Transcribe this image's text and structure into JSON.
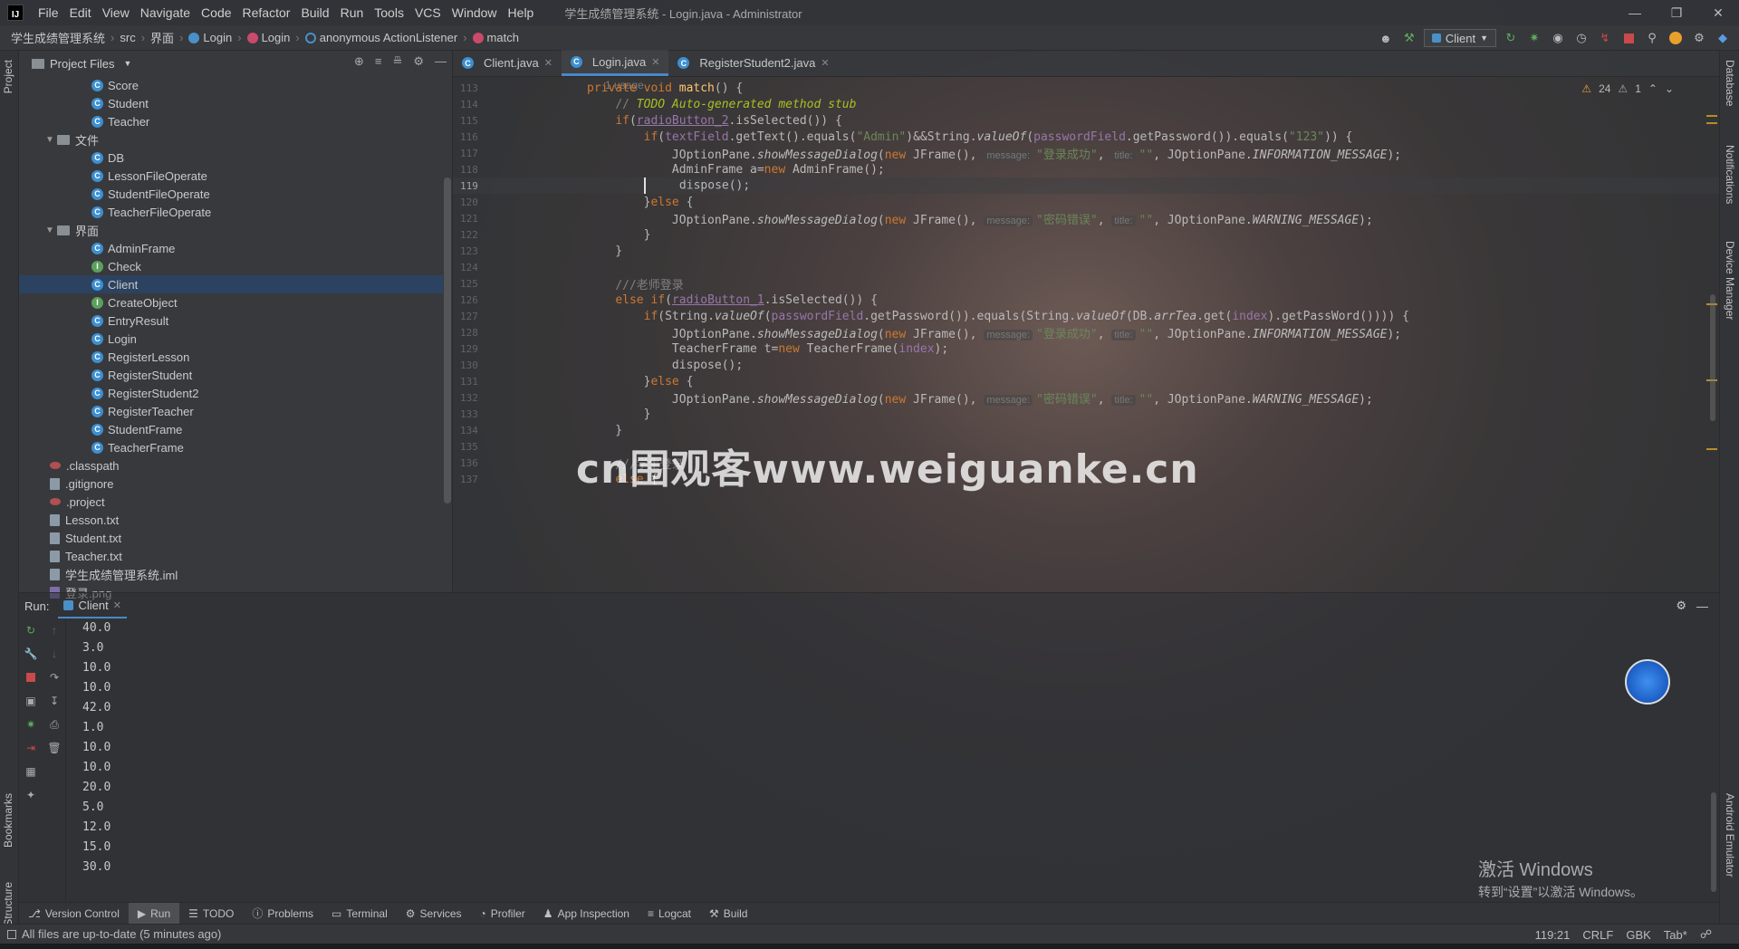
{
  "titlebar": {
    "logo": "IJ",
    "menus": [
      "File",
      "Edit",
      "View",
      "Navigate",
      "Code",
      "Refactor",
      "Build",
      "Run",
      "Tools",
      "VCS",
      "Window",
      "Help"
    ],
    "title": "学生成绩管理系统 - Login.java - Administrator"
  },
  "breadcrumbs": [
    "学生成绩管理系统",
    "src",
    "界面",
    "Login",
    "Login",
    "anonymous ActionListener",
    "match"
  ],
  "run_config": "Client",
  "project_panel": {
    "title": "Project Files",
    "tree": [
      {
        "label": "Score",
        "kind": "class",
        "indent": 3
      },
      {
        "label": "Student",
        "kind": "class",
        "indent": 3
      },
      {
        "label": "Teacher",
        "kind": "class",
        "indent": 3
      },
      {
        "label": "文件",
        "kind": "folder",
        "indent": 2
      },
      {
        "label": "DB",
        "kind": "class",
        "indent": 3
      },
      {
        "label": "LessonFileOperate",
        "kind": "class",
        "indent": 3
      },
      {
        "label": "StudentFileOperate",
        "kind": "class",
        "indent": 3
      },
      {
        "label": "TeacherFileOperate",
        "kind": "class",
        "indent": 3
      },
      {
        "label": "界面",
        "kind": "folder",
        "indent": 2
      },
      {
        "label": "AdminFrame",
        "kind": "class",
        "indent": 3
      },
      {
        "label": "Check",
        "kind": "iface",
        "indent": 3
      },
      {
        "label": "Client",
        "kind": "class",
        "indent": 3,
        "selected": true
      },
      {
        "label": "CreateObject",
        "kind": "iface",
        "indent": 3
      },
      {
        "label": "EntryResult",
        "kind": "class",
        "indent": 3
      },
      {
        "label": "Login",
        "kind": "class",
        "indent": 3
      },
      {
        "label": "RegisterLesson",
        "kind": "class",
        "indent": 3
      },
      {
        "label": "RegisterStudent",
        "kind": "class",
        "indent": 3
      },
      {
        "label": "RegisterStudent2",
        "kind": "class",
        "indent": 3
      },
      {
        "label": "RegisterTeacher",
        "kind": "class",
        "indent": 3
      },
      {
        "label": "StudentFrame",
        "kind": "class",
        "indent": 3
      },
      {
        "label": "TeacherFrame",
        "kind": "class",
        "indent": 3
      },
      {
        "label": ".classpath",
        "kind": "dot",
        "indent": 1
      },
      {
        "label": ".gitignore",
        "kind": "file",
        "indent": 1
      },
      {
        "label": ".project",
        "kind": "dot",
        "indent": 1
      },
      {
        "label": "Lesson.txt",
        "kind": "file",
        "indent": 1
      },
      {
        "label": "Student.txt",
        "kind": "file",
        "indent": 1
      },
      {
        "label": "Teacher.txt",
        "kind": "file",
        "indent": 1
      },
      {
        "label": "学生成绩管理系统.iml",
        "kind": "file",
        "indent": 1
      },
      {
        "label": "登录.png",
        "kind": "png",
        "indent": 1
      }
    ]
  },
  "tabs": [
    {
      "label": "Client.java",
      "active": false
    },
    {
      "label": "Login.java",
      "active": true
    },
    {
      "label": "RegisterStudent2.java",
      "active": false
    }
  ],
  "inspections": {
    "warnings": "24",
    "weak": "1"
  },
  "editor": {
    "usage_hint": "1 usage",
    "lines": [
      {
        "n": "113",
        "html": "<span class='kw'>private void </span><span class='fn'>match</span>() {"
      },
      {
        "n": "114",
        "html": "    <span class='cm'>// </span><span class='todo'>TODO Auto-generated method stub</span>"
      },
      {
        "n": "115",
        "html": "    <span class='kw'>if</span>(<span class='fld und'>radioButton_2</span>.isSelected()) {"
      },
      {
        "n": "116",
        "html": "        <span class='kw'>if</span>(<span class='fld'>textField</span>.getText().equals(<span class='str'>\"Admin\"</span>)&amp;&amp;String.<span class='st'>valueOf</span>(<span class='fld'>passwordField</span>.getPassword()).equals(<span class='str'>\"123\"</span>)) {"
      },
      {
        "n": "117",
        "html": "            JOptionPane.<span class='st'>showMessageDialog</span>(<span class='kw'>new </span>JFrame(), <span class='hint'>message:</span><span class='str'>\"登录成功\"</span>, <span class='hint'>title:</span><span class='str'>\"\"</span>, JOptionPane.<span class='fld st'>INFORMATION_MESSAGE</span>);"
      },
      {
        "n": "118",
        "html": "            AdminFrame a=<span class='kw'>new </span>AdminFrame();"
      },
      {
        "n": "119",
        "html": "        <span class='caret'></span>    dispose();",
        "cur": true
      },
      {
        "n": "120",
        "html": "        }<span class='kw'>else </span>{"
      },
      {
        "n": "121",
        "html": "            JOptionPane.<span class='st'>showMessageDialog</span>(<span class='kw'>new </span>JFrame(), <span class='hint'>message:</span><span class='str'>\"密码错误\"</span>, <span class='hint'>title:</span><span class='str'>\"\"</span>, JOptionPane.<span class='fld st'>WARNING_MESSAGE</span>);"
      },
      {
        "n": "122",
        "html": "        }"
      },
      {
        "n": "123",
        "html": "    }"
      },
      {
        "n": "124",
        "html": ""
      },
      {
        "n": "125",
        "html": "    <span class='cm'>///老师登录</span>"
      },
      {
        "n": "126",
        "html": "    <span class='kw'>else if</span>(<span class='fld und'>radioButton_1</span>.isSelected()) {"
      },
      {
        "n": "127",
        "html": "        <span class='kw'>if</span>(String.<span class='st'>valueOf</span>(<span class='fld'>passwordField</span>.getPassword()).equals(String.<span class='st'>valueOf</span>(DB.<span class='fld st'>arrTea</span>.get(<span class='fld'>index</span>).getPassWord()))) {"
      },
      {
        "n": "128",
        "html": "            JOptionPane.<span class='st'>showMessageDialog</span>(<span class='kw'>new </span>JFrame(), <span class='hint'>message:</span><span class='str'>\"登录成功\"</span>, <span class='hint'>title:</span><span class='str'>\"\"</span>, JOptionPane.<span class='fld st'>INFORMATION_MESSAGE</span>);"
      },
      {
        "n": "129",
        "html": "            TeacherFrame t=<span class='kw'>new </span>TeacherFrame(<span class='fld'>index</span>);"
      },
      {
        "n": "130",
        "html": "            dispose();"
      },
      {
        "n": "131",
        "html": "        }<span class='kw'>else </span>{"
      },
      {
        "n": "132",
        "html": "            JOptionPane.<span class='st'>showMessageDialog</span>(<span class='kw'>new </span>JFrame(), <span class='hint'>message:</span><span class='str'>\"密码错误\"</span>, <span class='hint'>title:</span><span class='str'>\"\"</span>, JOptionPane.<span class='fld st'>WARNING_MESSAGE</span>);"
      },
      {
        "n": "133",
        "html": "        }"
      },
      {
        "n": "134",
        "html": "    }"
      },
      {
        "n": "135",
        "html": ""
      },
      {
        "n": "136",
        "html": "    <span class='cm'>///学生登录</span>"
      },
      {
        "n": "137",
        "html": "    <span class='kw'>else </span>{"
      }
    ]
  },
  "watermark": "cn围观客www.weiguanke.cn",
  "run_panel": {
    "label": "Run:",
    "tab": "Client",
    "output": [
      "40.0",
      "3.0",
      "10.0",
      "10.0",
      "42.0",
      "1.0",
      "10.0",
      "10.0",
      "20.0",
      "5.0",
      "12.0",
      "15.0",
      "30.0"
    ]
  },
  "activation": {
    "line1": "激活 Windows",
    "line2": "转到“设置”以激活 Windows。"
  },
  "left_tabs": [
    "Project",
    "Bookmarks",
    "Structure"
  ],
  "right_tabs": [
    "Database",
    "Notifications",
    "Device Manager",
    "Android Emulator"
  ],
  "toolwindows": [
    "Version Control",
    "Run",
    "TODO",
    "Problems",
    "Terminal",
    "Services",
    "Profiler",
    "App Inspection",
    "Logcat",
    "Build"
  ],
  "status": {
    "message": "All files are up-to-date (5 minutes ago)",
    "position": "119:21",
    "line_sep": "CRLF",
    "encoding": "GBK",
    "indent": "Tab*"
  }
}
